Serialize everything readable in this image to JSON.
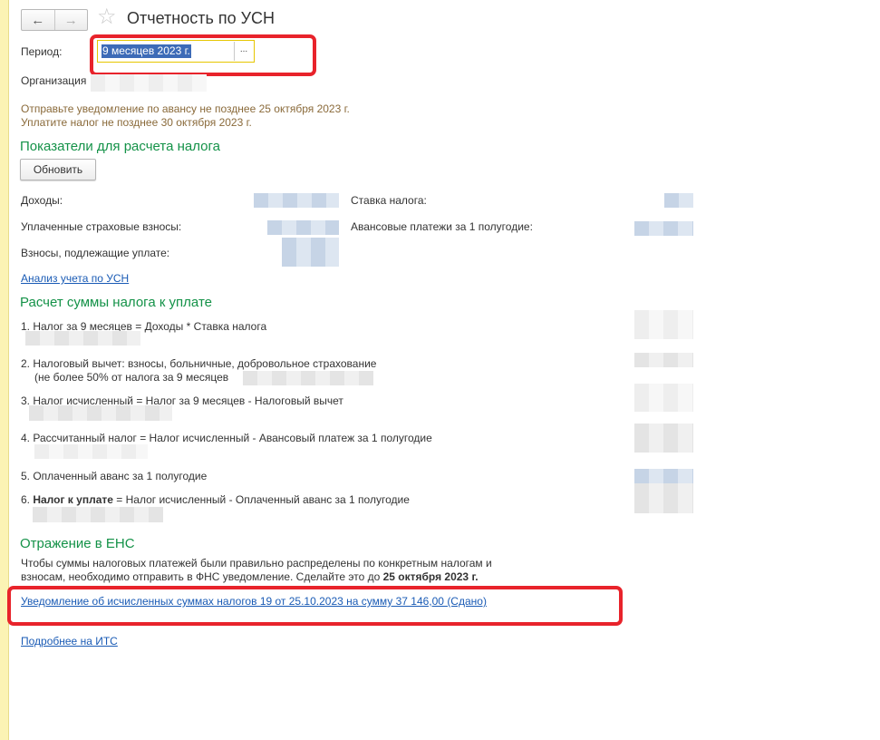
{
  "window": {
    "title": "Отчетность по УСН",
    "nav": {
      "back_icon": "←",
      "forward_icon": "→",
      "favorite_icon": "☆"
    }
  },
  "period": {
    "label": "Период:",
    "value": "9 месяцев 2023 г.",
    "select_button": "..."
  },
  "organization": {
    "label": "Организация"
  },
  "notices": {
    "line1": "Отправьте уведомление по авансу не позднее 25 октября 2023 г.",
    "line2": "Уплатите налог не позднее 30 октября 2023 г."
  },
  "indicators": {
    "heading": "Показатели для расчета налога",
    "refresh_button": "Обновить",
    "income_label": "Доходы:",
    "tax_rate_label": "Ставка налога:",
    "paid_insurance_label": "Уплаченные страховые взносы:",
    "advance_h1_label": "Авансовые платежи за 1 полугодие:",
    "contributions_due_label": "Взносы, подлежащие уплате:",
    "analysis_link": "Анализ учета по УСН"
  },
  "calculation": {
    "heading": "Расчет суммы налога к уплате",
    "line1": "1. Налог за 9 месяцев = Доходы * Ставка налога",
    "line2a": "2. Налоговый вычет: взносы, больничные, добровольное страхование",
    "line2b": "(не более 50% от налога за 9 месяцев",
    "line3": "3. Налог исчисленный = Налог за 9 месяцев - Налоговый вычет",
    "line4": "4. Рассчитанный налог = Налог исчисленный - Авансовый платеж за 1 полугодие",
    "line5": "5. Оплаченный аванс за 1 полугодие",
    "line6_prefix": "6. ",
    "line6_bold": "Налог к уплате",
    "line6_rest": " = Налог исчисленный - Оплаченный аванс за 1 полугодие"
  },
  "ens": {
    "heading": "Отражение в ЕНС",
    "text1": "Чтобы суммы налоговых платежей были правильно распределены по конкретным налогам и",
    "text2": "взносам, необходимо отправить в ФНС уведомление. Сделайте это до ",
    "text2_bold": "25 октября 2023 г.",
    "notification_link": "Уведомление об исчисленных суммах налогов 19 от 25.10.2023 на сумму 37 146,00 (Сдано)",
    "its_link": "Подробнее на ИТС"
  },
  "colors": {
    "section_heading": "#149248",
    "link": "#1a5bb5",
    "notice": "#8a6a3a",
    "highlight_frame": "#e8232b",
    "selection": "#3d6bb7"
  }
}
